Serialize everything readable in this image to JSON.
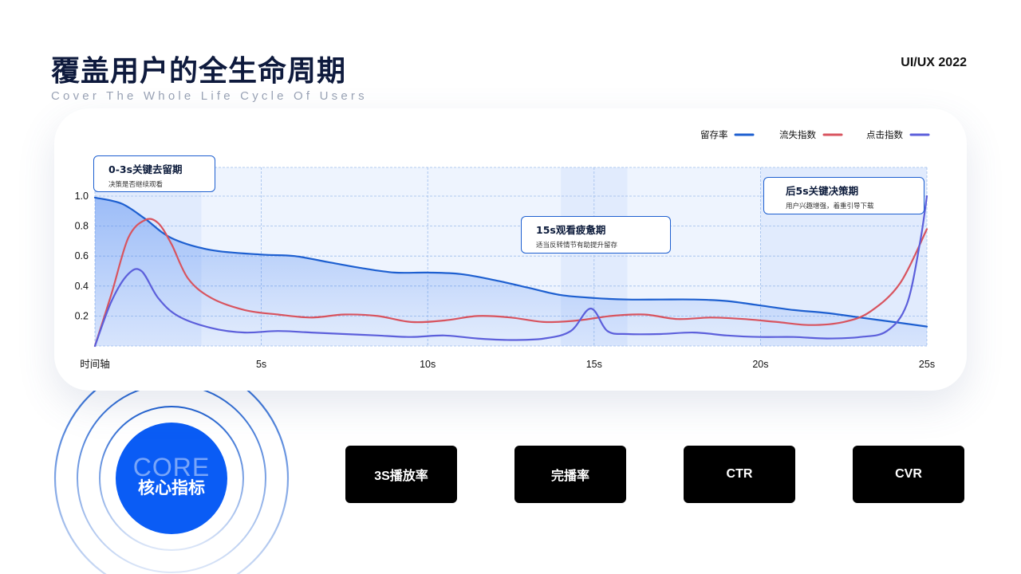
{
  "header": {
    "title": "覆盖用户的全生命周期",
    "subtitle": "Cover The Whole Life Cycle Of Users",
    "brand": "UI/UX 2022"
  },
  "colors": {
    "retention": "#1d5fd0",
    "churn": "#d8545f",
    "click": "#5c5fdb",
    "accent_blue": "#0a5cf5",
    "tile_bg": "#000000"
  },
  "chart_data": {
    "type": "line",
    "x_ticks": [
      "时间轴",
      "5s",
      "10s",
      "15s",
      "20s",
      "25s"
    ],
    "y_ticks": [
      "0.2",
      "0.4",
      "0.6",
      "0.8",
      "1.0"
    ],
    "xlim": [
      0,
      25
    ],
    "ylim": [
      0,
      1.0
    ],
    "grid": true,
    "legend_position": "top-right",
    "series": [
      {
        "name": "留存率",
        "color": "#1d5fd0",
        "filled": true,
        "x": [
          0,
          0.8,
          1.5,
          2.3,
          3.5,
          5,
          6,
          7,
          8,
          9,
          10,
          11,
          12,
          13,
          14,
          15,
          16,
          17,
          18,
          19,
          20,
          21,
          22,
          23,
          24,
          25
        ],
        "y": [
          0.99,
          0.95,
          0.85,
          0.72,
          0.64,
          0.61,
          0.6,
          0.56,
          0.52,
          0.49,
          0.49,
          0.48,
          0.44,
          0.39,
          0.34,
          0.32,
          0.31,
          0.31,
          0.31,
          0.3,
          0.27,
          0.24,
          0.22,
          0.19,
          0.16,
          0.13
        ]
      },
      {
        "name": "流失指数",
        "color": "#d8545f",
        "x": [
          0,
          0.5,
          1,
          1.5,
          1.9,
          2.3,
          2.8,
          3.5,
          4.5,
          5.5,
          6.5,
          7.5,
          8.5,
          9.5,
          10.5,
          11.5,
          12.5,
          13.5,
          14.5,
          15.5,
          16.5,
          17.5,
          18.5,
          19.5,
          20.5,
          21.5,
          22.5,
          23.3,
          24.2,
          25
        ],
        "y": [
          0.0,
          0.35,
          0.72,
          0.84,
          0.82,
          0.68,
          0.45,
          0.32,
          0.24,
          0.21,
          0.19,
          0.21,
          0.2,
          0.16,
          0.17,
          0.2,
          0.19,
          0.16,
          0.17,
          0.2,
          0.21,
          0.18,
          0.19,
          0.18,
          0.16,
          0.14,
          0.16,
          0.23,
          0.42,
          0.78
        ]
      },
      {
        "name": "点击指数",
        "color": "#5c5fdb",
        "x": [
          0,
          0.5,
          1,
          1.4,
          1.9,
          2.5,
          3.5,
          4.5,
          5.5,
          6.5,
          7.5,
          8.5,
          9.5,
          10.5,
          11.5,
          12.5,
          13.5,
          14.3,
          14.9,
          15.4,
          16,
          17,
          18,
          19,
          20,
          21,
          22,
          23,
          23.8,
          24.4,
          24.8,
          25
        ],
        "y": [
          0.0,
          0.3,
          0.48,
          0.5,
          0.32,
          0.2,
          0.12,
          0.09,
          0.1,
          0.09,
          0.08,
          0.07,
          0.06,
          0.07,
          0.05,
          0.04,
          0.05,
          0.1,
          0.25,
          0.1,
          0.08,
          0.08,
          0.09,
          0.07,
          0.06,
          0.06,
          0.05,
          0.06,
          0.1,
          0.28,
          0.7,
          1.0
        ]
      }
    ],
    "shaded_bands": [
      {
        "from": 0,
        "to": 3.2
      },
      {
        "from": 14,
        "to": 16
      },
      {
        "from": 20,
        "to": 25
      }
    ],
    "annotations": [
      {
        "title": "0-3s关键去留期",
        "subtitle": "决策是否继续观看"
      },
      {
        "title": "15s观看疲惫期",
        "subtitle": "适当反转情节有助提升留存"
      },
      {
        "title": "后5s关键决策期",
        "subtitle": "用户兴趣增强，着重引导下载"
      }
    ]
  },
  "core": {
    "label_en": "CORE",
    "label_cn": "核心指标"
  },
  "metrics": [
    "3S播放率",
    "完播率",
    "CTR",
    "CVR"
  ]
}
